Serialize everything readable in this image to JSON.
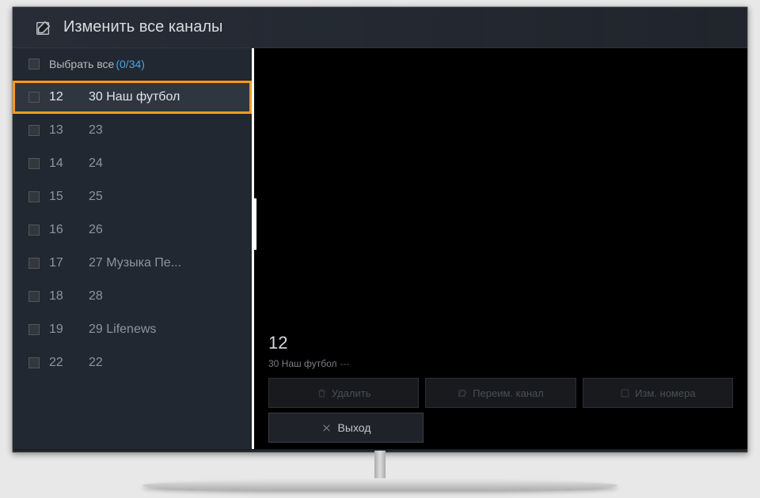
{
  "header": {
    "title": "Изменить все каналы"
  },
  "selectAll": {
    "label": "Выбрать все",
    "count": "(0/34)"
  },
  "channels": [
    {
      "num": "12",
      "name": "30 Наш футбол",
      "highlighted": true
    },
    {
      "num": "13",
      "name": "23"
    },
    {
      "num": "14",
      "name": "24"
    },
    {
      "num": "15",
      "name": "25"
    },
    {
      "num": "16",
      "name": "26"
    },
    {
      "num": "17",
      "name": "27 Музыка Пе..."
    },
    {
      "num": "18",
      "name": "28"
    },
    {
      "num": "19",
      "name": "29 Lifenews"
    },
    {
      "num": "22",
      "name": "22"
    }
  ],
  "info": {
    "num": "12",
    "name": "30 Наш футбол",
    "suffix": "---"
  },
  "buttons": {
    "delete": "Удалить",
    "rename": "Переим. канал",
    "renumber": "Изм. номера",
    "exit": "Выход"
  }
}
